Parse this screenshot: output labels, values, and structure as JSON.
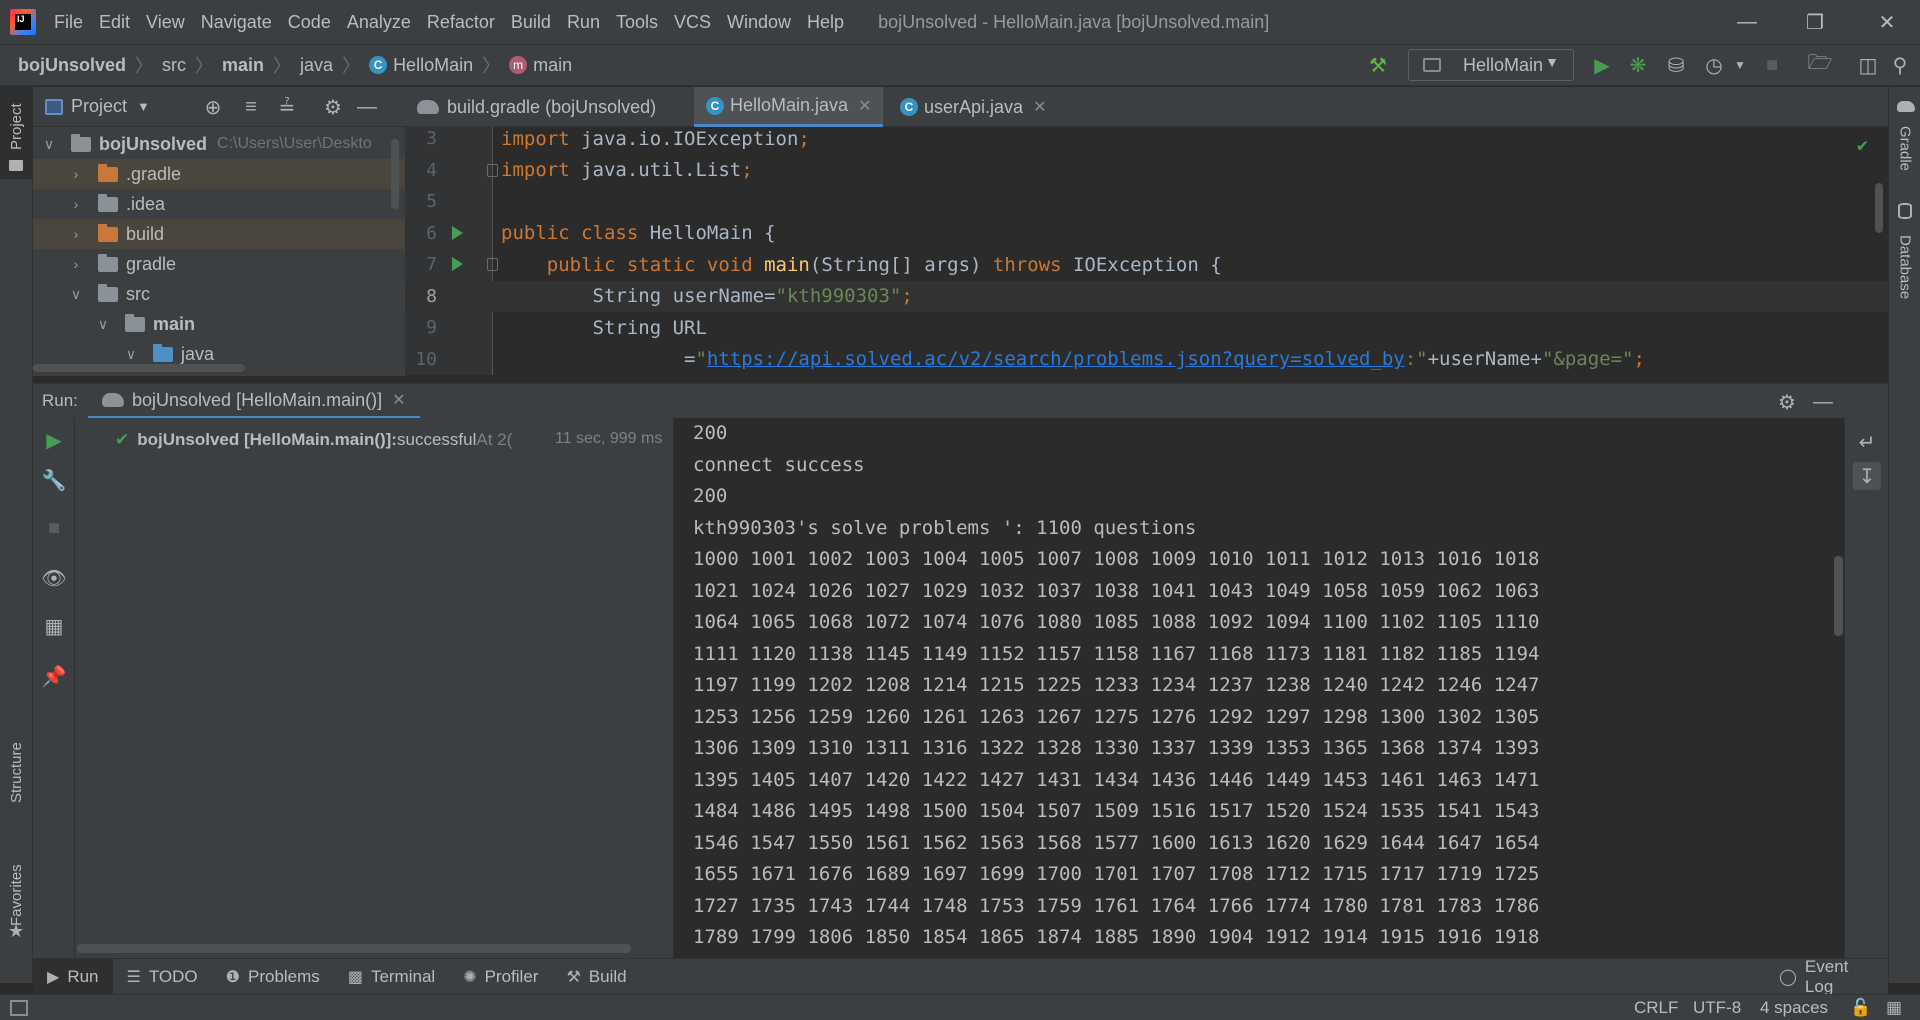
{
  "menu": {
    "logo": "IJ",
    "items": [
      "File",
      "Edit",
      "View",
      "Navigate",
      "Code",
      "Analyze",
      "Refactor",
      "Build",
      "Run",
      "Tools",
      "VCS",
      "Window",
      "Help"
    ],
    "window_title": "bojUnsolved - HelloMain.java [bojUnsolved.main]"
  },
  "navbar": {
    "crumbs": [
      "bojUnsolved",
      "src",
      "main",
      "java",
      "HelloMain",
      "main"
    ],
    "run_config": "HelloMain"
  },
  "project": {
    "title": "Project",
    "tree": [
      {
        "label": "bojUnsolved",
        "hint": "C:\\Users\\User\\Deskto"
      },
      {
        "label": ".gradle"
      },
      {
        "label": ".idea"
      },
      {
        "label": "build"
      },
      {
        "label": "gradle"
      },
      {
        "label": "src"
      },
      {
        "label": "main"
      },
      {
        "label": "java"
      }
    ]
  },
  "editor": {
    "tabs": [
      "build.gradle (bojUnsolved)",
      "HelloMain.java",
      "userApi.java"
    ],
    "line_numbers": [
      "3",
      "4",
      "5",
      "6",
      "7",
      "8",
      "9",
      "10"
    ],
    "code": {
      "l3": {
        "kw": "import",
        "rest": " java.io.IOException",
        "semi": ";"
      },
      "l4": {
        "kw": "import",
        "rest": " java.util.List",
        "semi": ";"
      },
      "l6": {
        "kw": "public class",
        "rest": " HelloMain {"
      },
      "l7": {
        "kw1": "public static void ",
        "fn": "main",
        "args": "(String[] args) ",
        "kw2": "throws",
        "rest": " IOException {"
      },
      "l8": {
        "pre": "        String userName=",
        "str": "\"kth990303\"",
        "semi": ";"
      },
      "l9": {
        "text": "        String URL"
      },
      "l10": {
        "pre": "                =",
        "q1": "\"",
        "url": "https://api.solved.ac/v2/search/problems.json?query=solved_by",
        "q2": ":\"",
        "mid": "+userName+",
        "str2": "\"&page=\"",
        "semi": ";"
      }
    }
  },
  "run_panel": {
    "label": "Run:",
    "tab": "bojUnsolved [HelloMain.main()]",
    "tree_node": "bojUnsolved [HelloMain.main()]:",
    "tree_status": " successful",
    "tree_time_prefix": " At 2(",
    "tree_duration": "11 sec, 999 ms",
    "console_lines": [
      "200",
      "connect success",
      "200",
      "kth990303's solve problems ': 1100 questions",
      "1000 1001 1002 1003 1004 1005 1007 1008 1009 1010 1011 1012 1013 1016 1018",
      "1021 1024 1026 1027 1029 1032 1037 1038 1041 1043 1049 1058 1059 1062 1063",
      "1064 1065 1068 1072 1074 1076 1080 1085 1088 1092 1094 1100 1102 1105 1110",
      "1111 1120 1138 1145 1149 1152 1157 1158 1167 1168 1173 1181 1182 1185 1194",
      "1197 1199 1202 1208 1214 1215 1225 1233 1234 1237 1238 1240 1242 1246 1247",
      "1253 1256 1259 1260 1261 1263 1267 1275 1276 1292 1297 1298 1300 1302 1305",
      "1306 1309 1310 1311 1316 1322 1328 1330 1337 1339 1353 1365 1368 1374 1393",
      "1395 1405 1407 1420 1422 1427 1431 1434 1436 1446 1449 1453 1461 1463 1471",
      "1484 1486 1495 1498 1500 1504 1507 1509 1516 1517 1520 1524 1535 1541 1543",
      "1546 1547 1550 1561 1562 1563 1568 1577 1600 1613 1620 1629 1644 1647 1654",
      "1655 1671 1676 1689 1697 1699 1700 1701 1707 1708 1712 1715 1717 1719 1725",
      "1727 1735 1743 1744 1748 1753 1759 1761 1764 1766 1774 1780 1781 1783 1786",
      "1789 1799 1806 1850 1854 1865 1874 1885 1890 1904 1912 1914 1915 1916 1918"
    ]
  },
  "left_strip": {
    "project": "Project",
    "structure": "Structure",
    "favorites": "Favorites"
  },
  "right_strip": {
    "gradle": "Gradle",
    "database": "Database"
  },
  "bottom_tabs": [
    "Run",
    "TODO",
    "Problems",
    "Terminal",
    "Profiler",
    "Build"
  ],
  "status": {
    "event_log": "Event Log",
    "line_sep": "CRLF",
    "encoding": "UTF-8",
    "indent": "4 spaces"
  }
}
